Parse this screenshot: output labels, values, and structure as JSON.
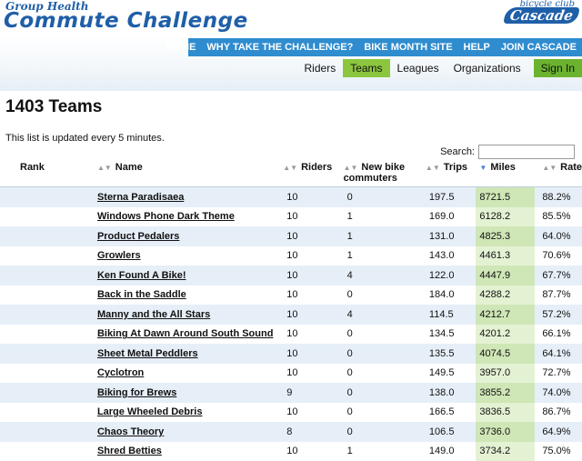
{
  "logo": {
    "top": "Group Health",
    "main": "Commute Challenge"
  },
  "cascade": {
    "small": "bicycle club",
    "main": "Cascade"
  },
  "nav": [
    "HOME",
    "WHY TAKE THE CHALLENGE?",
    "BIKE MONTH SITE",
    "HELP",
    "JOIN CASCADE"
  ],
  "subnav": {
    "riders": "Riders",
    "teams": "Teams",
    "leagues": "Leagues",
    "organizations": "Organizations",
    "signin": "Sign In"
  },
  "page": {
    "title": "1403 Teams",
    "note": "This list is updated every 5 minutes.",
    "search_label": "Search:"
  },
  "columns": {
    "rank": "Rank",
    "name": "Name",
    "riders": "Riders",
    "new": "New bike commuters",
    "trips": "Trips",
    "miles": "Miles",
    "rate": "Rate"
  },
  "rows": [
    {
      "name": "Sterna Paradisaea",
      "riders": "10",
      "new": "0",
      "trips": "197.5",
      "miles": "8721.5",
      "rate": "88.2%"
    },
    {
      "name": "Windows Phone Dark Theme",
      "riders": "10",
      "new": "1",
      "trips": "169.0",
      "miles": "6128.2",
      "rate": "85.5%"
    },
    {
      "name": "Product Pedalers",
      "riders": "10",
      "new": "1",
      "trips": "131.0",
      "miles": "4825.3",
      "rate": "64.0%"
    },
    {
      "name": "Growlers",
      "riders": "10",
      "new": "1",
      "trips": "143.0",
      "miles": "4461.3",
      "rate": "70.6%"
    },
    {
      "name": "Ken Found A Bike!",
      "riders": "10",
      "new": "4",
      "trips": "122.0",
      "miles": "4447.9",
      "rate": "67.7%"
    },
    {
      "name": "Back in the Saddle",
      "riders": "10",
      "new": "0",
      "trips": "184.0",
      "miles": "4288.2",
      "rate": "87.7%"
    },
    {
      "name": "Manny and the All Stars",
      "riders": "10",
      "new": "4",
      "trips": "114.5",
      "miles": "4212.7",
      "rate": "57.2%"
    },
    {
      "name": "Biking At Dawn Around South Sound",
      "riders": "10",
      "new": "0",
      "trips": "134.5",
      "miles": "4201.2",
      "rate": "66.1%"
    },
    {
      "name": "Sheet Metal Peddlers",
      "riders": "10",
      "new": "0",
      "trips": "135.5",
      "miles": "4074.5",
      "rate": "64.1%"
    },
    {
      "name": "Cyclotron",
      "riders": "10",
      "new": "0",
      "trips": "149.5",
      "miles": "3957.0",
      "rate": "72.7%"
    },
    {
      "name": "Biking for Brews",
      "riders": "9",
      "new": "0",
      "trips": "138.0",
      "miles": "3855.2",
      "rate": "74.0%"
    },
    {
      "name": "Large Wheeled Debris",
      "riders": "10",
      "new": "0",
      "trips": "166.5",
      "miles": "3836.5",
      "rate": "86.7%"
    },
    {
      "name": "Chaos Theory",
      "riders": "8",
      "new": "0",
      "trips": "106.5",
      "miles": "3736.0",
      "rate": "64.9%"
    },
    {
      "name": "Shred Betties",
      "riders": "10",
      "new": "1",
      "trips": "149.0",
      "miles": "3734.2",
      "rate": "75.0%"
    }
  ]
}
